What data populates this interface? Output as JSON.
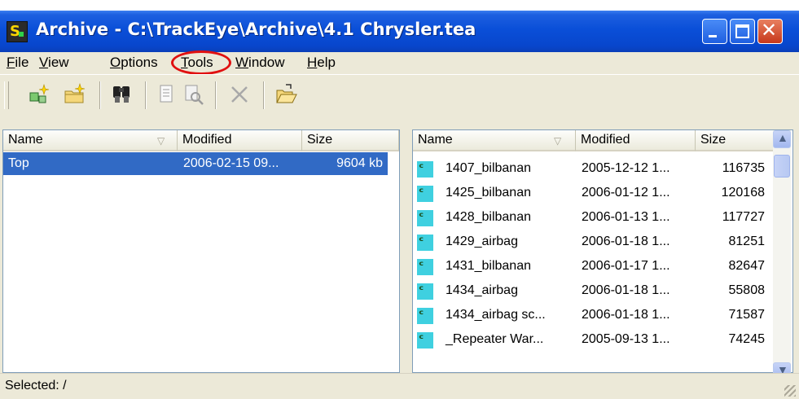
{
  "window": {
    "title": "Archive - C:\\TrackEye\\Archive\\4.1 Chrysler.tea"
  },
  "menu": [
    {
      "label": "File",
      "key": "F",
      "rest": "ile"
    },
    {
      "label": "View",
      "key": "V",
      "rest": "iew"
    },
    {
      "label": "Options",
      "key": "O",
      "rest": "ptions"
    },
    {
      "label": "Tools",
      "key": "T",
      "rest": "ools"
    },
    {
      "label": "Window",
      "key": "W",
      "rest": "indow"
    },
    {
      "label": "Help",
      "key": "H",
      "rest": "elp"
    }
  ],
  "toolbar": [
    "new-archive-icon",
    "new-folder-icon",
    "find-icon",
    "properties-icon",
    "preview-icon",
    "delete-icon",
    "open-folder-icon"
  ],
  "left_panel": {
    "columns": [
      "Name",
      "Modified",
      "Size"
    ],
    "rows": [
      {
        "name": "Top",
        "modified": "2006-02-15 09...",
        "size": "9604 kb"
      }
    ]
  },
  "right_panel": {
    "columns": [
      "Name",
      "Modified",
      "Size"
    ],
    "rows": [
      {
        "name": "1407_bilbanan",
        "modified": "2005-12-12 1...",
        "size": "116735"
      },
      {
        "name": "1425_bilbanan",
        "modified": "2006-01-12 1...",
        "size": "120168"
      },
      {
        "name": "1428_bilbanan",
        "modified": "2006-01-13 1...",
        "size": "117727"
      },
      {
        "name": "1429_airbag",
        "modified": "2006-01-18 1...",
        "size": "81251"
      },
      {
        "name": "1431_bilbanan",
        "modified": "2006-01-17 1...",
        "size": "82647"
      },
      {
        "name": "1434_airbag",
        "modified": "2006-01-18 1...",
        "size": "55808"
      },
      {
        "name": "1434_airbag sc...",
        "modified": "2006-01-18 1...",
        "size": "71587"
      },
      {
        "name": "_Repeater War...",
        "modified": "2005-09-13 1...",
        "size": "74245"
      }
    ]
  },
  "status": {
    "text": "Selected: /"
  },
  "colors": {
    "selection": "#316ac5",
    "highlight_circle": "#e01010",
    "title_bar": "#0a4fd8"
  }
}
